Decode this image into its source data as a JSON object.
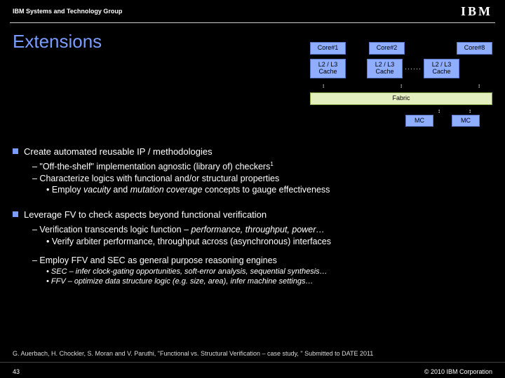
{
  "header": {
    "group": "IBM Systems and Technology Group",
    "logo": "IBM"
  },
  "title": "Extensions",
  "diagram": {
    "cores": [
      "Core#1",
      "Core#2",
      "Core#8"
    ],
    "caches": [
      "L2 / L3 Cache",
      "L2 / L3 Cache",
      "L2 / L3 Cache"
    ],
    "ellipsis": "······",
    "fabric": "Fabric",
    "mc": [
      "MC",
      "MC"
    ]
  },
  "bullets": {
    "b1": "Create automated reusable IP / methodologies",
    "b1s1_pre": "– \"Off-the-shelf\" implementation agnostic (library of) checkers",
    "b1s1_sup": "1",
    "b1s2": "– Characterize logics with functional and/or structural properties",
    "b1s2a_pre": "• Employ ",
    "b1s2a_em1": "vacuity",
    "b1s2a_mid": " and ",
    "b1s2a_em2": "mutation coverage",
    "b1s2a_post": " concepts to gauge effectiveness",
    "b2": "Leverage FV to check aspects beyond functional verification",
    "b2s1_pre": "– Verification transcends logic function – ",
    "b2s1_em": "performance, throughput, power…",
    "b2s1a": "• Verify arbiter performance, throughput across (asynchronous) interfaces",
    "b2s2": "– Employ FFV and SEC as general purpose reasoning engines",
    "b2s2a": "• SEC – infer clock-gating opportunities, soft-error analysis, sequential synthesis…",
    "b2s2b": "• FFV – optimize data structure logic (e.g. size, area), infer machine settings…"
  },
  "reference": "G. Auerbach, H. Chockler, S. Moran and V. Paruthi, \"Functional vs. Structural Verification – case study, \" Submitted to DATE 2011",
  "footer": {
    "page": "43",
    "copyright": "© 2010 IBM Corporation"
  }
}
